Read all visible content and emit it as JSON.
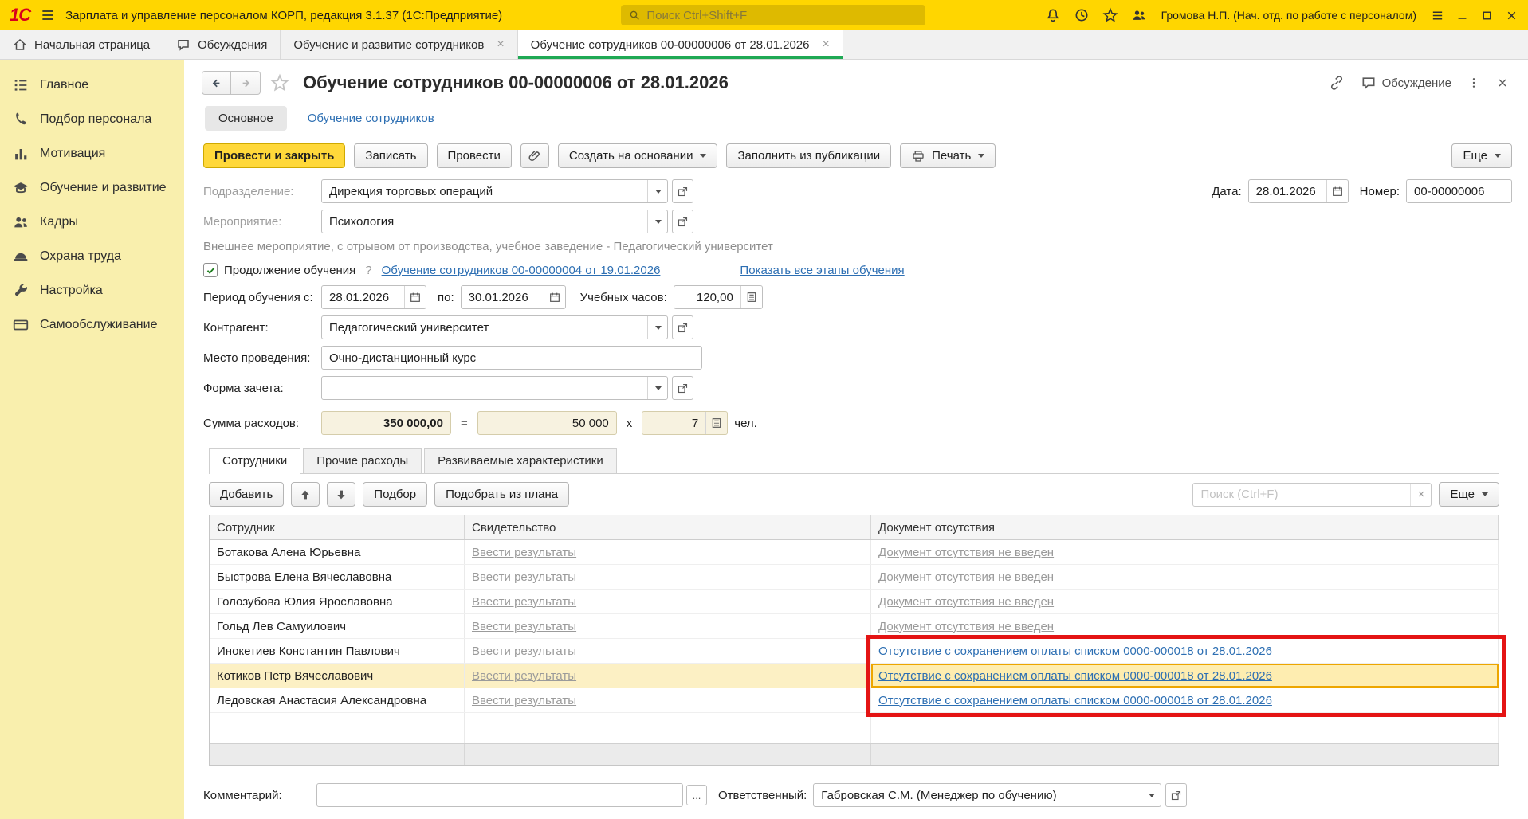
{
  "topbar": {
    "app_title": "Зарплата и управление персоналом КОРП, редакция 3.1.37 (1С:Предприятие)",
    "search_placeholder": "Поиск Ctrl+Shift+F",
    "user_name": "Громова Н.П. (Нач. отд. по работе с персоналом)"
  },
  "tabbar": {
    "home_label": "Начальная страница",
    "discussions_label": "Обсуждения",
    "doc_tabs": [
      {
        "label": "Обучение и развитие сотрудников"
      },
      {
        "label": "Обучение сотрудников 00-00000006 от 28.01.2026"
      }
    ]
  },
  "sidebar": {
    "items": [
      {
        "label": "Главное"
      },
      {
        "label": "Подбор персонала"
      },
      {
        "label": "Мотивация"
      },
      {
        "label": "Обучение и развитие"
      },
      {
        "label": "Кадры"
      },
      {
        "label": "Охрана труда"
      },
      {
        "label": "Настройка"
      },
      {
        "label": "Самообслуживание"
      }
    ]
  },
  "doc": {
    "title": "Обучение сотрудников 00-00000006 от 28.01.2026",
    "discussion_label": "Обсуждение",
    "subtab_main": "Основное",
    "subtab_link": "Обучение сотрудников",
    "toolbar": {
      "post_and_close": "Провести и закрыть",
      "save": "Записать",
      "post": "Провести",
      "create_based_on": "Создать на основании",
      "fill_from_publication": "Заполнить из публикации",
      "print": "Печать",
      "more": "Еще"
    },
    "fields": {
      "department_label": "Подразделение:",
      "department_value": "Дирекция торговых операций",
      "date_label": "Дата:",
      "date_value": "28.01.2026",
      "number_label": "Номер:",
      "number_value": "00-00000006",
      "event_label": "Мероприятие:",
      "event_value": "Психология",
      "event_note": "Внешнее мероприятие, с отрывом от производства, учебное заведение - Педагогический университет",
      "continuation_label": "Продолжение обучения",
      "continuation_help": "?",
      "continuation_doc_link": "Обучение сотрудников 00-00000004 от 19.01.2026",
      "show_all_stages_link": "Показать все этапы обучения",
      "period_from_label": "Период обучения с:",
      "period_from_value": "28.01.2026",
      "period_to_label": "по:",
      "period_to_value": "30.01.2026",
      "hours_label": "Учебных часов:",
      "hours_value": "120,00",
      "contractor_label": "Контрагент:",
      "contractor_value": "Педагогический университет",
      "venue_label": "Место проведения:",
      "venue_value": "Очно-дистанционный курс",
      "credit_form_label": "Форма зачета:",
      "amount_label": "Сумма расходов:",
      "amount_total": "350 000,00",
      "amount_equals": "=",
      "amount_per_person": "50 000",
      "amount_times": "x",
      "amount_people_count": "7",
      "amount_unit": "чел."
    },
    "grid": {
      "tabs": [
        {
          "label": "Сотрудники"
        },
        {
          "label": "Прочие расходы"
        },
        {
          "label": "Развиваемые характеристики"
        }
      ],
      "toolbar": {
        "add": "Добавить",
        "pick": "Подбор",
        "pick_from_plan": "Подобрать из плана",
        "search_placeholder": "Поиск (Ctrl+F)",
        "more": "Еще"
      },
      "columns": [
        {
          "label": "Сотрудник"
        },
        {
          "label": "Свидетельство"
        },
        {
          "label": "Документ отсутствия"
        }
      ],
      "rows": [
        {
          "employee": "Ботакова Алена Юрьевна",
          "certificate": "Ввести результаты",
          "absence": "Документ отсутствия не введен"
        },
        {
          "employee": "Быстрова Елена Вячеславовна",
          "certificate": "Ввести результаты",
          "absence": "Документ отсутствия не введен"
        },
        {
          "employee": "Голозубова Юлия Ярославовна",
          "certificate": "Ввести результаты",
          "absence": "Документ отсутствия не введен"
        },
        {
          "employee": "Гольд Лев Самуилович",
          "certificate": "Ввести результаты",
          "absence": "Документ отсутствия не введен"
        },
        {
          "employee": "Инокетиев Константин Павлович",
          "certificate": "Ввести результаты",
          "absence": "Отсутствие с сохранением оплаты списком 0000-000018 от 28.01.2026"
        },
        {
          "employee": "Котиков Петр Вячеславович",
          "certificate": "Ввести результаты",
          "absence": "Отсутствие с сохранением оплаты списком 0000-000018 от 28.01.2026"
        },
        {
          "employee": "Ледовская Анастасия Александровна",
          "certificate": "Ввести результаты",
          "absence": "Отсутствие с сохранением оплаты списком 0000-000018 от 28.01.2026"
        }
      ]
    },
    "footer": {
      "comment_label": "Комментарий:",
      "ellipsis": "...",
      "responsible_label": "Ответственный:",
      "responsible_value": "Габровская С.М. (Менеджер по обучению)"
    }
  }
}
